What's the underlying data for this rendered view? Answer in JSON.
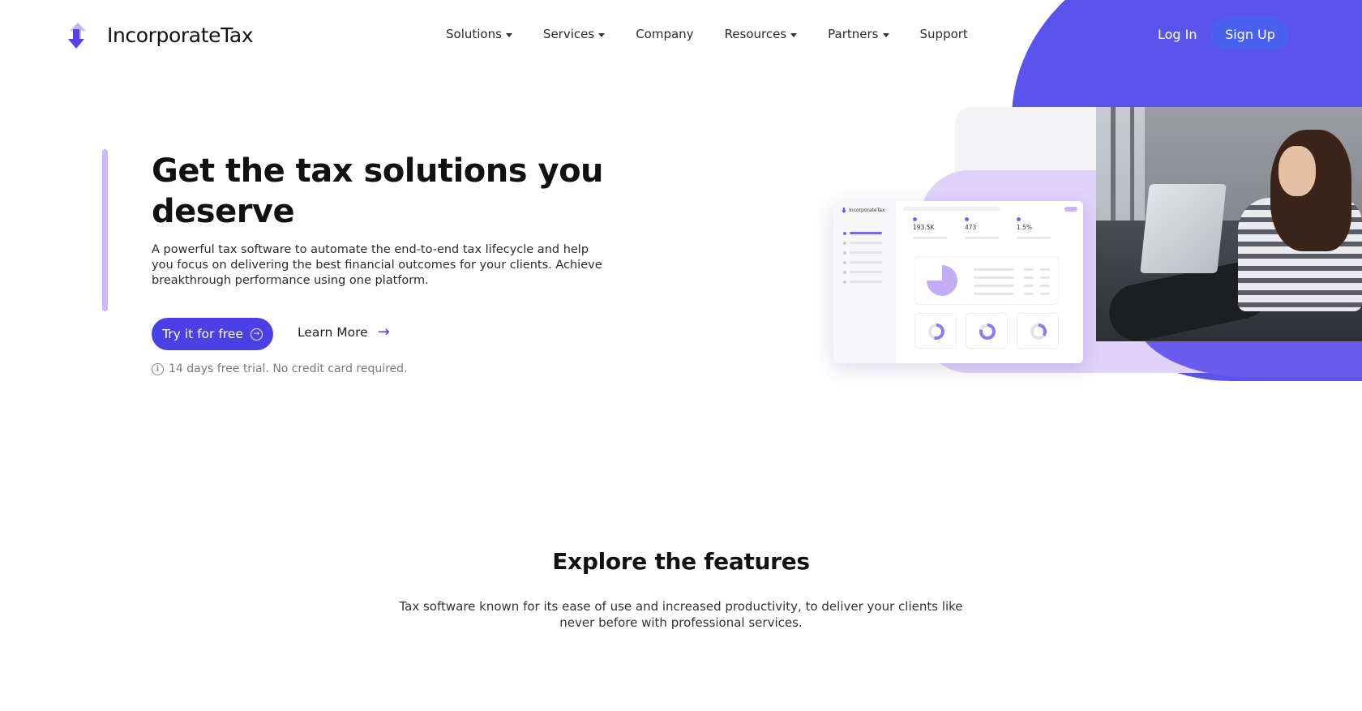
{
  "brand": {
    "name": "IncorporateTax"
  },
  "nav": {
    "items": [
      {
        "label": "Solutions",
        "dropdown": true
      },
      {
        "label": "Services",
        "dropdown": true
      },
      {
        "label": "Company",
        "dropdown": false
      },
      {
        "label": "Resources",
        "dropdown": true
      },
      {
        "label": "Partners",
        "dropdown": true
      },
      {
        "label": "Support",
        "dropdown": false
      }
    ],
    "login_label": "Log In",
    "signup_label": "Sign Up"
  },
  "hero": {
    "title": "Get the tax solutions you deserve",
    "description": "A powerful tax software to automate the end-to-end tax lifecycle and help you focus on delivering the best financial outcomes for your clients. Achieve breakthrough performance using one platform.",
    "primary_cta": "Try it for free",
    "secondary_cta": "Learn More",
    "note": "14 days free trial. No credit card required."
  },
  "dashboard_preview": {
    "brand": "IncorporateTax",
    "stats": [
      "193.5K",
      "473",
      "1.5%"
    ]
  },
  "features": {
    "title": "Explore the features",
    "description": "Tax software known for its ease of use and increased productivity, to deliver your clients like never before with professional services."
  },
  "colors": {
    "primary": "#4b3fe8",
    "accent_blob": "#5b54ec",
    "signup_button": "#4a61f0",
    "lilac": "#c9b9f6"
  }
}
